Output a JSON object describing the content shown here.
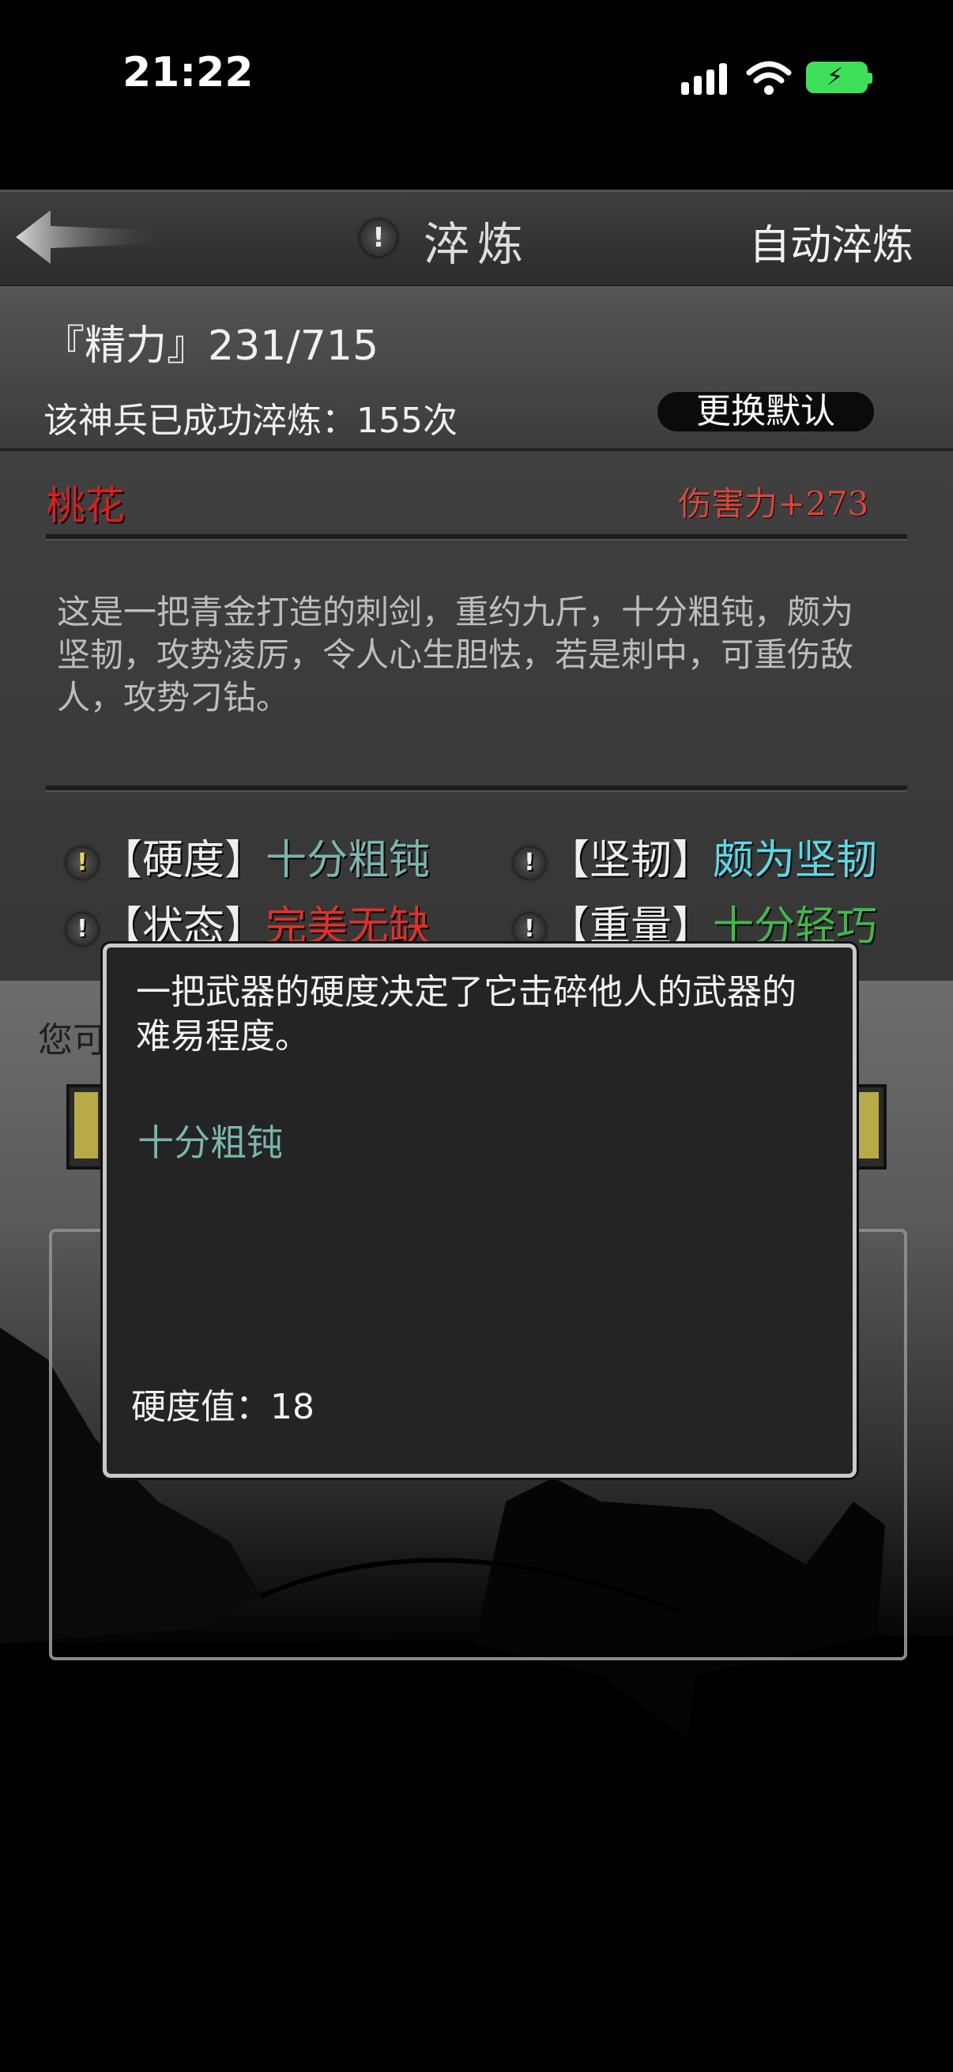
{
  "status": {
    "time": "21:22"
  },
  "header": {
    "title": "淬炼",
    "info_badge": "!",
    "auto_button": "自动淬炼",
    "back_icon": "back-arrow-icon"
  },
  "stats": {
    "energy": "『精力』231/715",
    "refine_count": "该神兵已成功淬炼：155次",
    "change_default_button": "更换默认"
  },
  "weapon": {
    "name": "桃花",
    "damage": "伤害力+273",
    "description": "这是一把青金打造的刺剑，重约九斤，十分粗钝，颇为坚韧，攻势凌厉，令人心生胆怯，若是刺中，可重伤敌人，攻势刁钻。"
  },
  "attributes": [
    {
      "badge": "!",
      "key": "【硬度】",
      "value": "十分粗钝",
      "color": "#79b6b0"
    },
    {
      "badge": "!",
      "key": "【坚韧】",
      "value": "颇为坚韧",
      "color": "#57dbe8"
    },
    {
      "badge": "!",
      "key": "【状态】",
      "value": "完美无缺",
      "color": "#e0302a"
    },
    {
      "badge": "!",
      "key": "【重量】",
      "value": "十分轻巧",
      "color": "#3fb84c"
    }
  ],
  "background": {
    "hint": "您可"
  },
  "tooltip": {
    "text": "一把武器的硬度决定了它击碎他人的武器的难易程度。",
    "level": "十分粗钝",
    "value": "硬度值：18"
  }
}
